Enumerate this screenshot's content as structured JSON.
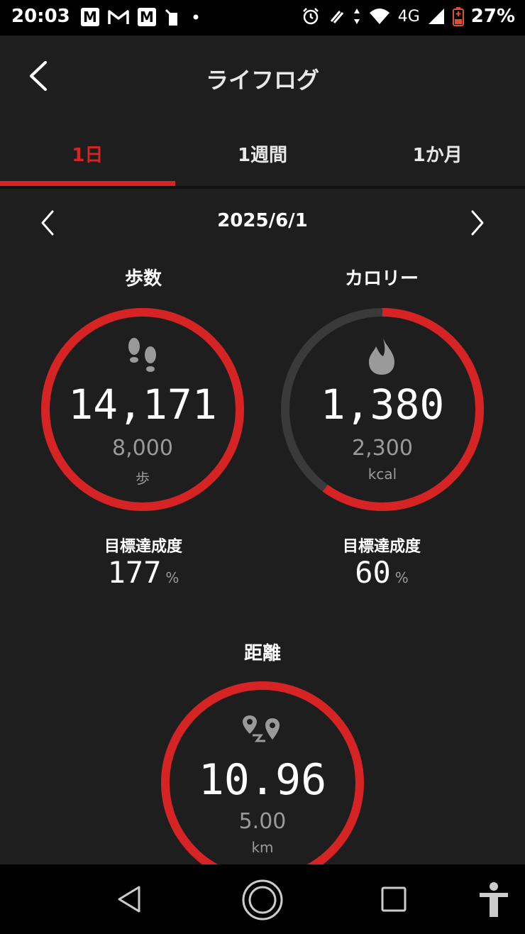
{
  "status_bar": {
    "time": "20:03",
    "left_icons": [
      "M",
      "gmail-icon",
      "M",
      "battery-saver-icon",
      "dot-icon"
    ],
    "network": "4G",
    "battery": "27%"
  },
  "header": {
    "title": "ライフログ"
  },
  "tabs": [
    {
      "label": "1日",
      "active": true
    },
    {
      "label": "1週間",
      "active": false
    },
    {
      "label": "1か月",
      "active": false
    }
  ],
  "date": "2025/6/1",
  "metrics": {
    "steps": {
      "label": "歩数",
      "value": "14,171",
      "goal": "8,000",
      "unit": "歩",
      "achievement_label": "目標達成度",
      "achievement": "177",
      "pct": "%",
      "progress": 1.0
    },
    "calories": {
      "label": "カロリー",
      "value": "1,380",
      "goal": "2,300",
      "unit": "kcal",
      "achievement_label": "目標達成度",
      "achievement": "60",
      "pct": "%",
      "progress": 0.6
    },
    "distance": {
      "label": "距離",
      "value": "10.96",
      "goal": "5.00",
      "unit": "km",
      "progress": 1.0
    }
  },
  "colors": {
    "accent": "#d62323",
    "track": "#3a3a3a",
    "background": "#1e1e1e"
  }
}
